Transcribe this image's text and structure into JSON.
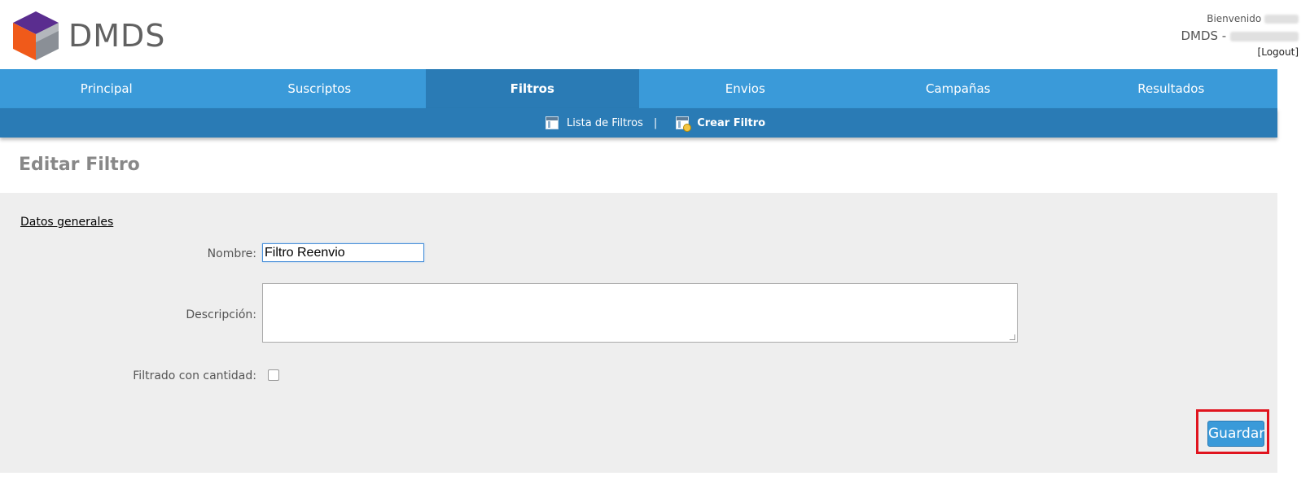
{
  "header": {
    "logo_text": "DMDS",
    "welcome_label": "Bienvenido",
    "app_label": "DMDS -",
    "logout_label": "[Logout]"
  },
  "nav": {
    "items": [
      {
        "label": "Principal"
      },
      {
        "label": "Suscriptos"
      },
      {
        "label": "Filtros"
      },
      {
        "label": "Envios"
      },
      {
        "label": "Campañas"
      },
      {
        "label": "Resultados"
      }
    ],
    "active": "Filtros"
  },
  "subnav": {
    "list_label": "Lista de Filtros",
    "separator": "|",
    "create_label": "Crear Filtro"
  },
  "page": {
    "title": "Editar Filtro",
    "section_title": "Datos generales"
  },
  "form": {
    "name_label": "Nombre:",
    "name_value": "Filtro Reenvio",
    "description_label": "Descripción:",
    "description_value": "",
    "quantity_label": "Filtrado con cantidad:",
    "quantity_checked": false,
    "save_label": "Guardar"
  },
  "colors": {
    "nav_bg": "#3a9ad9",
    "nav_active": "#2a7bb5",
    "highlight": "#e0141e"
  },
  "icons": {
    "logo": "cube-logo-icon",
    "list": "list-icon",
    "create": "create-filter-icon"
  }
}
